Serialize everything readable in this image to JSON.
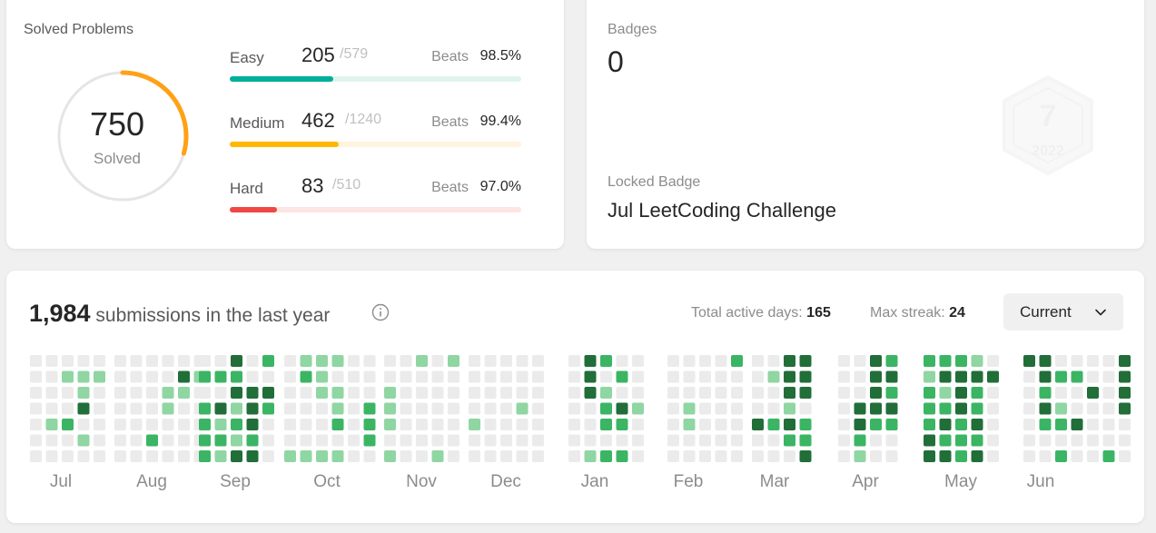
{
  "solved": {
    "title": "Solved Problems",
    "total": "750",
    "label": "Solved",
    "progress": 0.2936,
    "ring_color": "#ffa116",
    "difficulties": [
      {
        "name": "Easy",
        "solved": "205",
        "total": "/579",
        "beats_label": "Beats",
        "beats": "98.5%",
        "fill": 0.354,
        "color": "#00af9b",
        "track": "#e0f4ec"
      },
      {
        "name": "Medium",
        "solved": "462",
        "total": "/1240",
        "beats_label": "Beats",
        "beats": "99.4%",
        "fill": 0.3726,
        "color": "#ffb800",
        "track": "#fff4de"
      },
      {
        "name": "Hard",
        "solved": "83",
        "total": "/510",
        "beats_label": "Beats",
        "beats": "97.0%",
        "fill": 0.1627,
        "color": "#ef4743",
        "track": "#fde5e4"
      }
    ]
  },
  "badges": {
    "label": "Badges",
    "count": "0",
    "locked_label": "Locked Badge",
    "locked_name": "Jul LeetCoding Challenge",
    "badge_text": "7",
    "badge_year": "2022"
  },
  "submissions": {
    "count": "1,984",
    "suffix": " submissions in the last year",
    "active_days_label": "Total active days: ",
    "active_days": "165",
    "max_streak_label": "Max streak: ",
    "max_streak": "24",
    "range_select": "Current",
    "months": [
      "Jul",
      "Aug",
      "Sep",
      "Oct",
      "Nov",
      "Dec",
      "Jan",
      "Feb",
      "Mar",
      "Apr",
      "May",
      "Jun"
    ],
    "colors": [
      "#ebebeb",
      "#8fd6a3",
      "#3bb564",
      "#216e39",
      "#1a5a2e"
    ],
    "heatmap": [
      [
        [
          0,
          0,
          0,
          0,
          0,
          0,
          0
        ],
        [
          0,
          0,
          0,
          0,
          1,
          0,
          0
        ],
        [
          0,
          1,
          0,
          0,
          2,
          0,
          0
        ],
        [
          0,
          1,
          1,
          3,
          0,
          1,
          0
        ],
        [
          0,
          1,
          0,
          0,
          0,
          0,
          0
        ]
      ],
      [
        [
          0,
          0,
          0,
          0,
          0,
          0,
          0
        ],
        [
          0,
          0,
          0,
          0,
          0,
          0,
          0
        ],
        [
          0,
          0,
          0,
          0,
          0,
          2,
          0
        ],
        [
          0,
          0,
          1,
          1,
          0,
          0,
          0
        ],
        [
          0,
          3,
          1,
          0,
          0,
          0,
          0
        ],
        [
          0,
          1,
          0,
          0,
          0,
          0,
          0
        ]
      ],
      [
        [
          0,
          2,
          0,
          2,
          2,
          2,
          2
        ],
        [
          0,
          2,
          0,
          3,
          1,
          2,
          1
        ],
        [
          3,
          2,
          3,
          1,
          2,
          1,
          3
        ],
        [
          0,
          0,
          3,
          3,
          3,
          2,
          3
        ],
        [
          2,
          0,
          3,
          2,
          0,
          0,
          0
        ]
      ],
      [
        [
          0,
          0,
          0,
          0,
          0,
          0,
          1
        ],
        [
          1,
          2,
          0,
          0,
          0,
          0,
          1
        ],
        [
          1,
          1,
          1,
          0,
          0,
          0,
          1
        ],
        [
          1,
          0,
          1,
          1,
          2,
          0,
          1
        ],
        [
          0,
          0,
          0,
          0,
          0,
          0,
          0
        ],
        [
          0,
          0,
          0,
          2,
          2,
          2,
          0
        ]
      ],
      [
        [
          0,
          0,
          1,
          1,
          1,
          0,
          1
        ],
        [
          0,
          0,
          0,
          0,
          0,
          0,
          0
        ],
        [
          1,
          0,
          0,
          0,
          0,
          0,
          0
        ],
        [
          0,
          0,
          0,
          0,
          0,
          0,
          1
        ],
        [
          1,
          0,
          0,
          0,
          0,
          0,
          0
        ]
      ],
      [
        [
          0,
          0,
          0,
          0,
          1,
          0,
          0
        ],
        [
          0,
          0,
          0,
          0,
          0,
          0,
          0
        ],
        [
          0,
          0,
          0,
          0,
          0,
          0,
          0
        ],
        [
          0,
          0,
          0,
          1,
          0,
          0,
          0
        ],
        [
          0,
          0,
          0,
          0,
          0,
          0,
          0
        ]
      ],
      [
        [
          0,
          0,
          0,
          0,
          0,
          0,
          0
        ],
        [
          3,
          3,
          3,
          0,
          0,
          0,
          1
        ],
        [
          2,
          0,
          1,
          2,
          2,
          0,
          2
        ],
        [
          0,
          2,
          0,
          3,
          2,
          0,
          2
        ],
        [
          0,
          0,
          0,
          1,
          0,
          0,
          0
        ]
      ],
      [
        [
          0,
          0,
          0,
          0,
          0,
          0,
          0
        ],
        [
          0,
          0,
          0,
          1,
          1,
          0,
          0
        ],
        [
          0,
          0,
          0,
          0,
          0,
          0,
          0
        ],
        [
          0,
          0,
          0,
          0,
          0,
          0,
          0
        ],
        [
          2,
          0,
          0,
          0,
          0,
          0,
          0
        ]
      ],
      [
        [
          0,
          0,
          0,
          0,
          3,
          0,
          0
        ],
        [
          0,
          1,
          0,
          0,
          2,
          0,
          0
        ],
        [
          3,
          3,
          3,
          1,
          3,
          2,
          0
        ],
        [
          3,
          3,
          3,
          0,
          2,
          2,
          3
        ]
      ],
      [
        [
          0,
          0,
          0,
          0,
          0,
          0,
          0
        ],
        [
          0,
          0,
          0,
          3,
          3,
          2,
          1
        ],
        [
          3,
          3,
          3,
          3,
          2,
          0,
          0
        ],
        [
          2,
          3,
          2,
          3,
          2,
          0,
          0
        ]
      ],
      [
        [
          2,
          1,
          2,
          2,
          2,
          3,
          3
        ],
        [
          2,
          3,
          1,
          2,
          3,
          2,
          3
        ],
        [
          2,
          3,
          3,
          3,
          2,
          2,
          2
        ],
        [
          1,
          3,
          2,
          2,
          3,
          2,
          3
        ],
        [
          0,
          3,
          0,
          0,
          0,
          0,
          0
        ]
      ],
      [
        [
          3,
          0,
          0,
          0,
          0,
          0,
          0
        ],
        [
          3,
          3,
          2,
          3,
          2,
          0,
          0
        ],
        [
          0,
          2,
          0,
          1,
          2,
          0,
          2
        ],
        [
          0,
          2,
          0,
          0,
          3,
          0,
          0
        ],
        [
          0,
          0,
          3,
          0,
          0,
          0,
          0
        ],
        [
          0,
          0,
          0,
          0,
          0,
          0,
          2
        ],
        [
          3,
          3,
          3,
          3,
          0,
          0,
          0
        ]
      ]
    ]
  }
}
